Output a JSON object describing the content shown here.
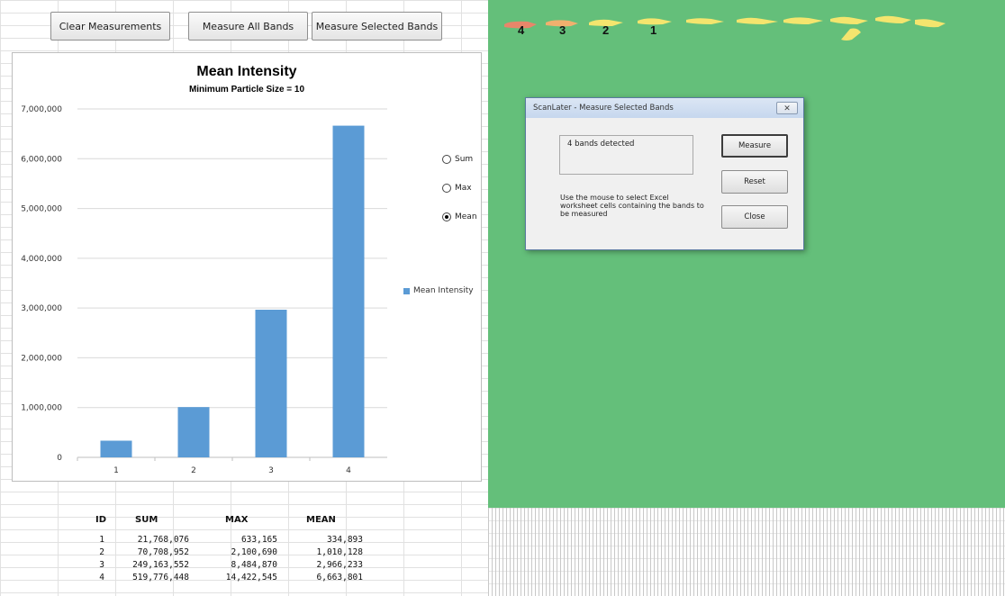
{
  "toolbar": {
    "clear_label": "Clear Measurements",
    "measure_all_label": "Measure All Bands",
    "measure_selected_label": "Measure Selected Bands"
  },
  "chart": {
    "title": "Mean Intensity",
    "subtitle": "Minimum Particle Size = 10",
    "legend_label": "Mean Intensity",
    "options": [
      {
        "label": "Sum",
        "selected": false
      },
      {
        "label": "Max",
        "selected": false
      },
      {
        "label": "Mean",
        "selected": true
      }
    ]
  },
  "chart_data": {
    "type": "bar",
    "title": "Mean Intensity",
    "subtitle": "Minimum Particle Size = 10",
    "categories": [
      "1",
      "2",
      "3",
      "4"
    ],
    "series": [
      {
        "name": "Mean Intensity",
        "values": [
          334893,
          1010128,
          2966233,
          6663801
        ]
      }
    ],
    "ylim": [
      0,
      7000000
    ],
    "yticks": [
      "0",
      "1,000,000",
      "2,000,000",
      "3,000,000",
      "4,000,000",
      "5,000,000",
      "6,000,000",
      "7,000,000"
    ],
    "grid": true,
    "legend_position": "right",
    "color": "#5b9bd5"
  },
  "table": {
    "headers": [
      "ID",
      "SUM",
      "MAX",
      "MEAN"
    ],
    "rows": [
      [
        "1",
        "21,768,076",
        "633,165",
        "334,893"
      ],
      [
        "2",
        "70,708,952",
        "2,100,690",
        "1,010,128"
      ],
      [
        "3",
        "249,163,552",
        "8,484,870",
        "2,966,233"
      ],
      [
        "4",
        "519,776,448",
        "14,422,545",
        "6,663,801"
      ]
    ]
  },
  "gel": {
    "band_labels": [
      "4",
      "3",
      "2",
      "1"
    ]
  },
  "dialog": {
    "title": "ScanLater - Measure Selected Bands",
    "status": "4 bands detected",
    "instructions": "Use the mouse to select Excel worksheet cells containing the bands to be measured",
    "measure_label": "Measure",
    "reset_label": "Reset",
    "close_label": "Close"
  },
  "colors": {
    "gel_background": "#64bf7a",
    "bar": "#5b9bd5",
    "band_yellow": "#f4e56e",
    "band_red": "#e8866a"
  }
}
